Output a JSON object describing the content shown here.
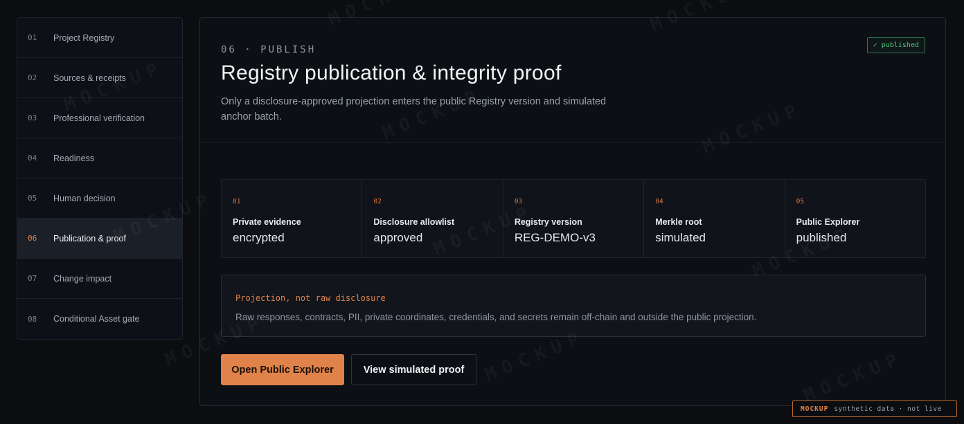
{
  "sidebar": {
    "items": [
      {
        "num": "01",
        "label": "Project Registry",
        "active": false
      },
      {
        "num": "02",
        "label": "Sources & receipts",
        "active": false
      },
      {
        "num": "03",
        "label": "Professional verification",
        "active": false
      },
      {
        "num": "04",
        "label": "Readiness",
        "active": false
      },
      {
        "num": "05",
        "label": "Human decision",
        "active": false
      },
      {
        "num": "06",
        "label": "Publication & proof",
        "active": true
      },
      {
        "num": "07",
        "label": "Change impact",
        "active": false
      },
      {
        "num": "08",
        "label": "Conditional Asset gate",
        "active": false
      }
    ]
  },
  "header": {
    "eyebrow": "06 · PUBLISH",
    "title": "Registry publication & integrity proof",
    "subtitle": "Only a disclosure-approved projection enters the public Registry version and simulated anchor batch.",
    "badge": "✓ published"
  },
  "steps": [
    {
      "num": "01",
      "label": "Private evidence",
      "value": "encrypted"
    },
    {
      "num": "02",
      "label": "Disclosure allowlist",
      "value": "approved"
    },
    {
      "num": "03",
      "label": "Registry version",
      "value": "REG-DEMO-v3"
    },
    {
      "num": "04",
      "label": "Merkle root",
      "value": "simulated"
    },
    {
      "num": "05",
      "label": "Public Explorer",
      "value": "published"
    }
  ],
  "note": {
    "title": "Projection, not raw disclosure",
    "body": "Raw responses, contracts, PII, private coordinates, credentials, and secrets remain off-chain and outside the public projection."
  },
  "actions": {
    "primary": "Open Public Explorer",
    "secondary": "View simulated proof"
  },
  "mockup_tag": {
    "strong": "MOCKUP",
    "text": "synthetic data · not live"
  },
  "watermark": "MOCKUP",
  "colors": {
    "accent": "#e0834a",
    "success": "#56c585",
    "background": "#0b0d11"
  }
}
